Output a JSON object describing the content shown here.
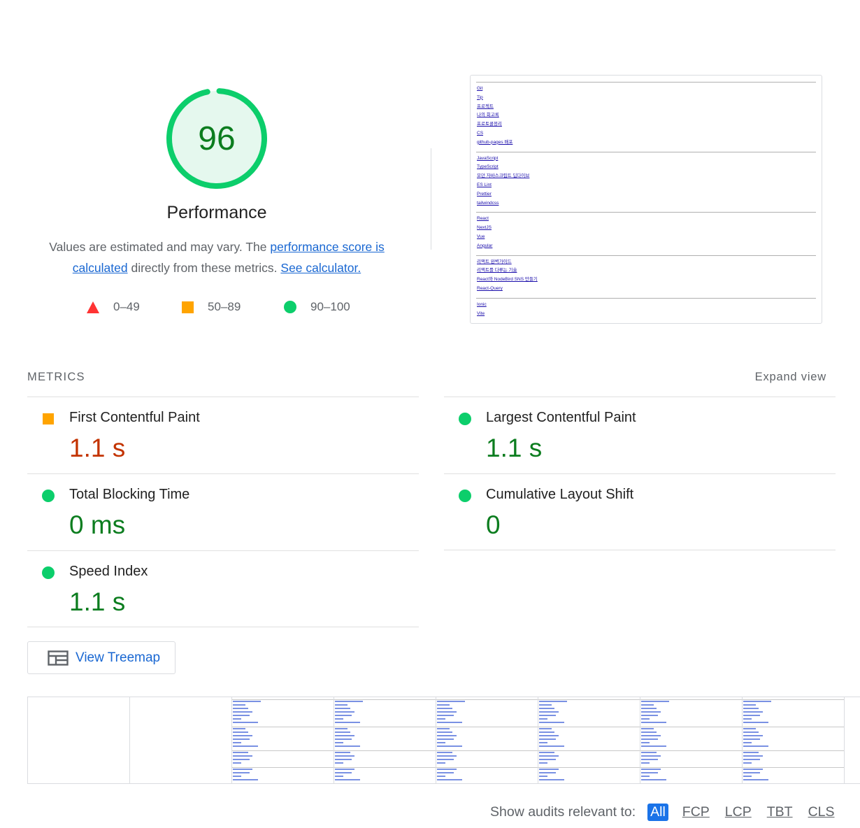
{
  "category": {
    "score": "96",
    "score_fraction": 0.96,
    "label": "Performance",
    "gauge_color": "#0cce6b",
    "gauge_fill": "#e5f8ee",
    "score_color": "#0c7d1f"
  },
  "description": {
    "prefix": "Values are estimated and may vary. The ",
    "link1": "performance score is calculated",
    "middle": " directly from these metrics. ",
    "link2": "See calculator."
  },
  "legend": [
    {
      "range": "0–49",
      "icon": "red-triangle-icon",
      "color": "#ff3333"
    },
    {
      "range": "50–89",
      "icon": "orange-square-icon",
      "color": "#ffa400"
    },
    {
      "range": "90–100",
      "icon": "green-circle-icon",
      "color": "#0cce6b"
    }
  ],
  "final_screenshot": {
    "groups": [
      [
        "Git",
        "Tip",
        "프로젝트",
        "나의 회고록",
        "프로토콜정리",
        "CS",
        "github-pages 배포"
      ],
      [
        "JavaScript",
        "TypeScript",
        "모던 자바스크립트 딥다이브",
        "ES Lint",
        "Prettier",
        "tailwindcss"
      ],
      [
        "React",
        "NextJS",
        "Vue",
        "Angular"
      ],
      [
        "리액트 완벽가이드",
        "리액트를 다루는 기술",
        "React와 NodeBird SNS 만들기",
        "React-Query"
      ],
      [
        "Ionic",
        "Vite"
      ]
    ]
  },
  "metrics_section": {
    "header": "METRICS",
    "expand": "Expand view",
    "items": [
      {
        "title": "First Contentful Paint",
        "value": "1.1 s",
        "rating": "average"
      },
      {
        "title": "Largest Contentful Paint",
        "value": "1.1 s",
        "rating": "pass"
      },
      {
        "title": "Total Blocking Time",
        "value": "0 ms",
        "rating": "pass"
      },
      {
        "title": "Cumulative Layout Shift",
        "value": "0",
        "rating": "pass"
      },
      {
        "title": "Speed Index",
        "value": "1.1 s",
        "rating": "pass"
      }
    ]
  },
  "treemap": {
    "label": "View Treemap",
    "icon": "treemap-icon"
  },
  "filmstrip": {
    "frames": 8
  },
  "audit_filter": {
    "label": "Show audits relevant to:",
    "options": [
      "All",
      "FCP",
      "LCP",
      "TBT",
      "CLS"
    ],
    "selected": "All"
  }
}
